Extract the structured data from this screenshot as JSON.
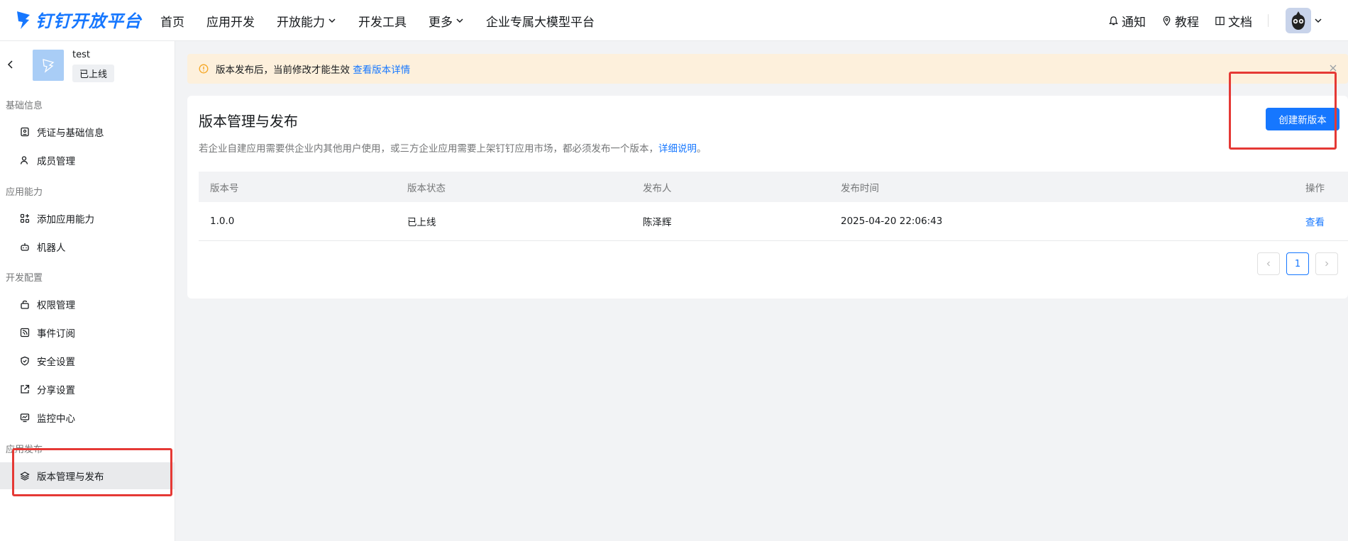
{
  "colors": {
    "accent": "#1677ff",
    "alert_bg": "#fdf0dc",
    "highlight": "#e53935"
  },
  "brand": {
    "name": "钉钉开放平台"
  },
  "nav": {
    "items": [
      {
        "label": "首页"
      },
      {
        "label": "应用开发"
      },
      {
        "label": "开放能力",
        "has_dropdown": true
      },
      {
        "label": "开发工具"
      },
      {
        "label": "更多",
        "has_dropdown": true
      },
      {
        "label": "企业专属大模型平台"
      }
    ],
    "right": {
      "notify": "通知",
      "tutorial": "教程",
      "docs": "文档"
    }
  },
  "app": {
    "name": "test",
    "status": "已上线"
  },
  "sidebar": {
    "sections": [
      {
        "title": "基础信息",
        "items": [
          {
            "label": "凭证与基础信息",
            "icon": "credential-icon"
          },
          {
            "label": "成员管理",
            "icon": "user-icon"
          }
        ]
      },
      {
        "title": "应用能力",
        "items": [
          {
            "label": "添加应用能力",
            "icon": "apps-add-icon"
          },
          {
            "label": "机器人",
            "icon": "robot-icon"
          }
        ]
      },
      {
        "title": "开发配置",
        "items": [
          {
            "label": "权限管理",
            "icon": "lock-icon"
          },
          {
            "label": "事件订阅",
            "icon": "rss-icon"
          },
          {
            "label": "安全设置",
            "icon": "shield-icon"
          },
          {
            "label": "分享设置",
            "icon": "share-icon"
          },
          {
            "label": "监控中心",
            "icon": "monitor-icon"
          }
        ]
      },
      {
        "title": "应用发布",
        "items": [
          {
            "label": "版本管理与发布",
            "icon": "layers-icon",
            "active": true
          }
        ]
      }
    ]
  },
  "alert": {
    "text": "版本发布后，当前修改才能生效",
    "link": "查看版本详情"
  },
  "main": {
    "title": "版本管理与发布",
    "desc": "若企业自建应用需要供企业内其他用户使用，或三方企业应用需要上架钉钉应用市场，都必须发布一个版本，",
    "desc_link": "详细说明",
    "desc_end": "。",
    "create_button": "创建新版本"
  },
  "table": {
    "headers": [
      "版本号",
      "版本状态",
      "发布人",
      "发布时间",
      "操作"
    ],
    "rows": [
      {
        "version": "1.0.0",
        "status": "已上线",
        "publisher": "陈泽辉",
        "time": "2025-04-20 22:06:43",
        "action": "查看"
      }
    ]
  },
  "pagination": {
    "current": "1"
  }
}
